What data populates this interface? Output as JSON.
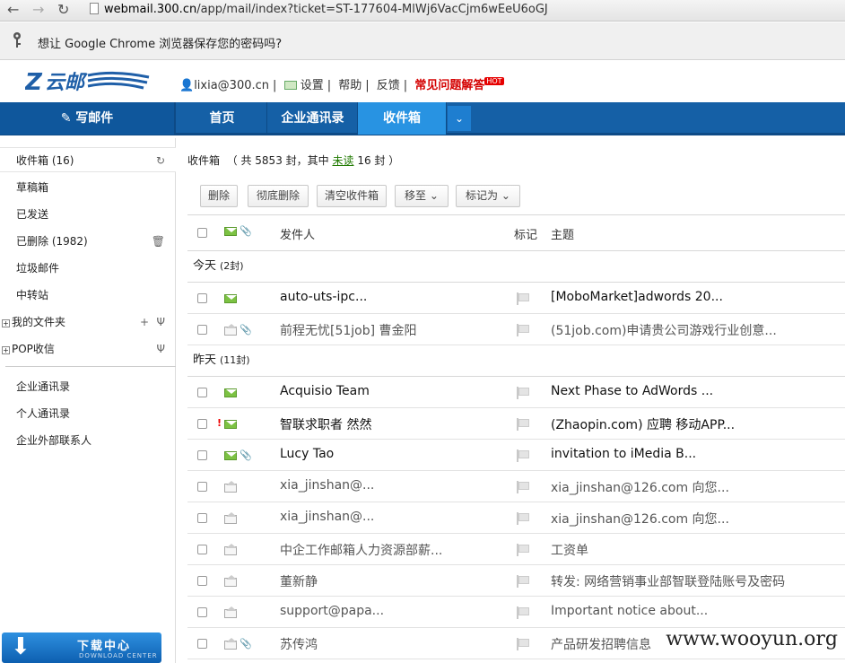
{
  "browser": {
    "url_host": "webmail.300.cn",
    "url_path": "/app/mail/index?ticket=ST-177604-MlWj6VacCjm6wEeU6oGJ",
    "save_password_prompt": "想让 Google Chrome 浏览器保存您的密码吗?"
  },
  "header": {
    "user_email": "lixia@300.cn",
    "links": [
      "设置",
      "帮助",
      "反馈"
    ],
    "faq_label": "常见问题解答",
    "hot_badge": "HOT"
  },
  "nav": {
    "compose_label": "写邮件",
    "tabs": [
      {
        "label": "首页"
      },
      {
        "label": "企业通讯录"
      },
      {
        "label": "收件箱"
      }
    ]
  },
  "sidebar": {
    "folders": [
      {
        "label": "收件箱 (16)"
      },
      {
        "label": "草稿箱"
      },
      {
        "label": "已发送"
      },
      {
        "label": "已删除 (1982)"
      },
      {
        "label": "垃圾邮件"
      },
      {
        "label": "中转站"
      },
      {
        "label": "我的文件夹"
      },
      {
        "label": "POP收信"
      }
    ],
    "contacts": [
      {
        "label": "企业通讯录"
      },
      {
        "label": "个人通讯录"
      },
      {
        "label": "企业外部联系人"
      }
    ],
    "download": {
      "title": "下载中心",
      "subtitle": "DOWNLOAD CENTER"
    }
  },
  "main": {
    "folder_name": "收件箱",
    "summary_prefix": "（ 共 5853 封，其中",
    "unread_label": "未读",
    "summary_suffix": "16 封 ）",
    "toolbar": {
      "delete": "删除",
      "purge": "彻底删除",
      "empty": "清空收件箱",
      "move": "移至",
      "mark": "标记为"
    },
    "columns": {
      "sender": "发件人",
      "flag": "标记",
      "subject": "主题"
    },
    "groups": [
      {
        "label": "今天",
        "count": "(2封)"
      },
      {
        "label": "昨天",
        "count": "(11封)"
      }
    ],
    "rows": [
      {
        "sender": "auto-uts-ipc...",
        "subject": "[MoboMarket]adwords 20..."
      },
      {
        "sender": "前程无忧[51job] 曹金阳",
        "subject": "(51job.com)申请贵公司游戏行业创意..."
      },
      {
        "sender": "Acquisio Team",
        "subject": "Next Phase to AdWords ..."
      },
      {
        "sender": "智联求职者 然然",
        "subject": "(Zhaopin.com) 应聘 移动APP..."
      },
      {
        "sender": "Lucy Tao",
        "subject": "invitation to iMedia B..."
      },
      {
        "sender": "xia_jinshan@...",
        "subject": "xia_jinshan@126.com 向您..."
      },
      {
        "sender": "xia_jinshan@...",
        "subject": "xia_jinshan@126.com 向您..."
      },
      {
        "sender": "中企工作邮箱人力资源部薪...",
        "subject": "工资单"
      },
      {
        "sender": "董新静",
        "subject": "转发: 网络营销事业部智联登陆账号及密码"
      },
      {
        "sender": "support@papa...",
        "subject": "Important notice about..."
      },
      {
        "sender": "苏传鸿",
        "subject": "产品研发招聘信息"
      }
    ]
  },
  "watermark": "www.wooyun.org",
  "colors": {
    "nav_blue": "#1560a6",
    "active_tab": "#2893e2",
    "unread_green": "#7cc243"
  }
}
